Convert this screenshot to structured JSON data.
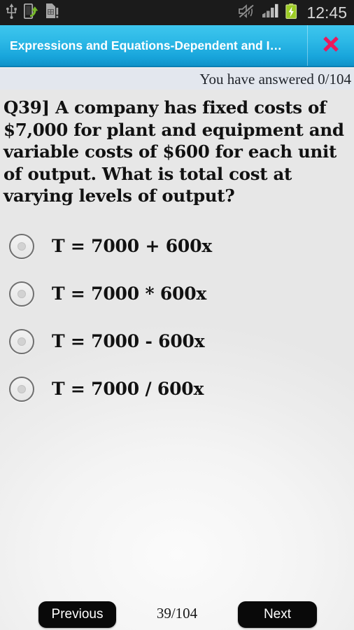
{
  "statusbar": {
    "time": "12:45",
    "left_icons": [
      "usb-icon",
      "phone-transfer-icon",
      "sim-card-alert-icon"
    ],
    "right_icons": [
      "mute-icon",
      "signal-bars-icon",
      "battery-charging-icon"
    ]
  },
  "titlebar": {
    "title": "Expressions and Equations-Dependent and I…",
    "close_label": "close-icon",
    "background_color": "#2cb8e6",
    "close_color": "#ea1a5c"
  },
  "status": {
    "answered_text": "You have answered 0/104"
  },
  "question": {
    "number_label": "Q39]",
    "text": "Q39]   A company has fixed costs of $7,000 for plant and equipment and variable costs of $600 for each unit of output. What is total cost at varying levels of output?",
    "options": [
      {
        "label": "T = 7000 + 600x",
        "selected": false
      },
      {
        "label": "T = 7000 * 600x",
        "selected": false
      },
      {
        "label": "T = 7000 - 600x",
        "selected": false
      },
      {
        "label": "T = 7000 / 600x",
        "selected": false
      }
    ]
  },
  "bottom_nav": {
    "previous_label": "Previous",
    "next_label": "Next",
    "page_counter": "39/104"
  }
}
